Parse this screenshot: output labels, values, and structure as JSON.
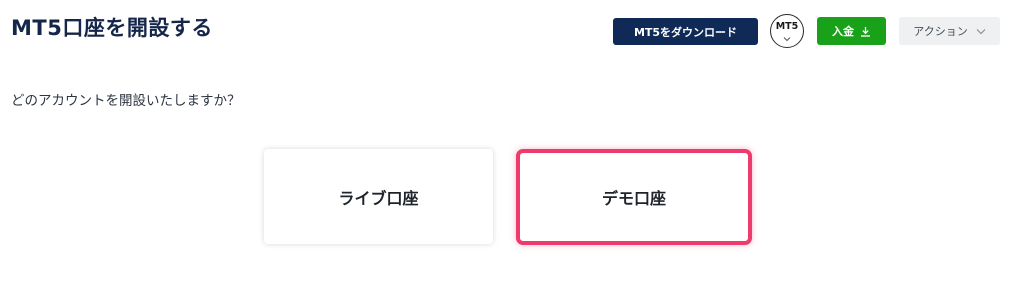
{
  "page": {
    "title": "MT5口座を開設する"
  },
  "toolbar": {
    "download_label": "MT5をダウンロード",
    "platform_badge": "MT5",
    "deposit_label": "入金",
    "action_label": "アクション"
  },
  "form": {
    "question": "どのアカウントを開設いたしますか？"
  },
  "account_options": [
    {
      "label": "ライブ口座",
      "selected": false
    },
    {
      "label": "デモ口座",
      "selected": true
    }
  ],
  "colors": {
    "title": "#15264a",
    "download_button": "#0f2a56",
    "deposit_button": "#1aa11a",
    "action_button": "#eef0f1",
    "selected_highlight": "#ee3b6d"
  },
  "icons": {
    "deposit": "download-icon",
    "action": "chevron-down-icon",
    "badge": "chevron-down-icon"
  }
}
